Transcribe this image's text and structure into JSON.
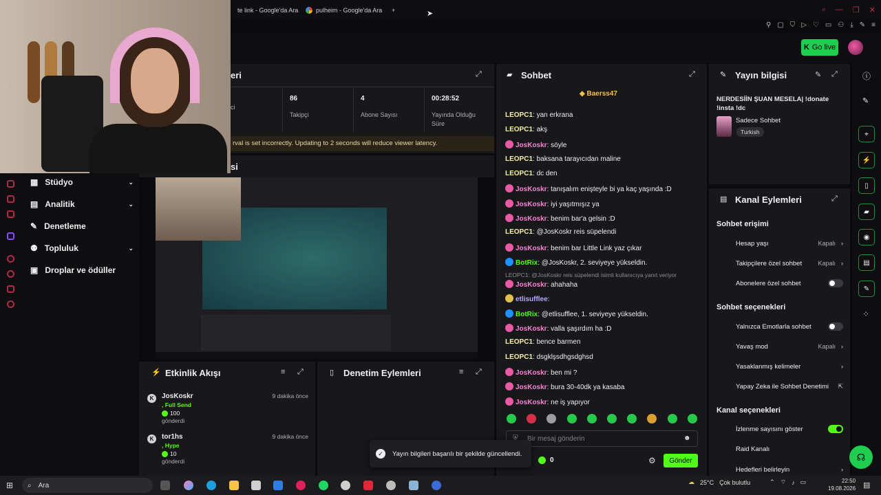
{
  "browser": {
    "tabs": [
      {
        "label": "te link - Google'da Ara"
      },
      {
        "label": "pulheim - Google'da Ara"
      }
    ],
    "new_tab_label": "+"
  },
  "header": {
    "go_live_label": "Go live"
  },
  "sidebar": {
    "items": [
      {
        "label": "Stüdyo",
        "expandable": true,
        "icon": "folder-icon"
      },
      {
        "label": "Analitik",
        "expandable": true,
        "icon": "chart-icon"
      },
      {
        "label": "Denetleme",
        "expandable": false,
        "icon": "wrench-icon"
      },
      {
        "label": "Topluluk",
        "expandable": true,
        "icon": "community-icon"
      },
      {
        "label": "Droplar ve ödüller",
        "expandable": false,
        "icon": "gift-icon"
      }
    ]
  },
  "stats": {
    "title_fragment": "eri",
    "cells": [
      {
        "value": "",
        "label": "ci"
      },
      {
        "value": "86",
        "label": "Takipçi"
      },
      {
        "value": "4",
        "label": "Abone Sayısı"
      },
      {
        "value": "00:28:52",
        "label": "Yayında Olduğu Süre"
      }
    ],
    "warning": "rval is set incorrectly. Updating to 2 seconds will reduce viewer latency."
  },
  "preview": {
    "title_fragment": "si"
  },
  "activity": {
    "title": "Etkinlik Akışı",
    "events": [
      {
        "user": "JosKoskr",
        "action": ", Full Send",
        "amount": "100",
        "verb": "gönderdi",
        "time": "9 dakika önce"
      },
      {
        "user": "tor1hs",
        "action": ", Hype",
        "amount": "10",
        "verb": "gönderdi",
        "time": "9 dakika önce"
      }
    ]
  },
  "moderation": {
    "title": "Denetim Eylemleri"
  },
  "chat": {
    "title": "Sohbet",
    "pinned_user": "Baerss47",
    "messages": [
      {
        "user": "LEOPC1",
        "text": "yan erkrana",
        "color": "#f5f0a8",
        "badge": ""
      },
      {
        "user": "LEOPC1",
        "text": "akş",
        "color": "#f5f0a8",
        "badge": ""
      },
      {
        "user": "JosKoskr",
        "text": "söyle",
        "color": "#ff7fd6",
        "badge": "#e85aa5"
      },
      {
        "user": "LEOPC1",
        "text": "baksana tarayıcıdan maline",
        "color": "#f5f0a8",
        "badge": ""
      },
      {
        "user": "LEOPC1",
        "text": "dc den",
        "color": "#f5f0a8",
        "badge": ""
      },
      {
        "user": "JosKoskr",
        "text": "tanışalım enişteyle bi ya kaç yaşında :D",
        "color": "#ff7fd6",
        "badge": "#e85aa5"
      },
      {
        "user": "JosKoskr",
        "text": "iyi yaşıtmışız ya",
        "color": "#ff7fd6",
        "badge": "#e85aa5"
      },
      {
        "user": "JosKoskr",
        "text": "benim bar'a gelsin :D",
        "color": "#ff7fd6",
        "badge": "#e85aa5"
      },
      {
        "user": "LEOPC1",
        "text": "@JosKoskr reis süpelendi",
        "color": "#f5f0a8",
        "badge": ""
      },
      {
        "user": "JosKoskr",
        "text": "benim bar Little Link yaz çıkar",
        "color": "#ff7fd6",
        "badge": "#e85aa5"
      },
      {
        "user": "BotRix",
        "text": "@JosKoskr, 2. seviyeye yükseldin.",
        "color": "#53fc18",
        "badge": "#1e90ff"
      },
      {
        "user": "JosKoskr",
        "text": "ahahaha",
        "color": "#ff7fd6",
        "badge": "#e85aa5"
      },
      {
        "user": "etlisufflee",
        "text": "",
        "color": "#b9a7ff",
        "badge": "#e0c04a"
      },
      {
        "user": "BotRix",
        "text": "@etlisufflee, 1. seviyeye yükseldin.",
        "color": "#53fc18",
        "badge": "#1e90ff"
      },
      {
        "user": "JosKoskr",
        "text": "valla şaşırdım ha :D",
        "color": "#ff7fd6",
        "badge": "#e85aa5"
      },
      {
        "user": "LEOPC1",
        "text": "bence barmen",
        "color": "#f5f0a8",
        "badge": ""
      },
      {
        "user": "LEOPC1",
        "text": "dsgklşsdhgsdghsd",
        "color": "#f5f0a8",
        "badge": ""
      },
      {
        "user": "JosKoskr",
        "text": "ben mi ?",
        "color": "#ff7fd6",
        "badge": "#e85aa5"
      },
      {
        "user": "JosKoskr",
        "text": "bura 30-40dk ya kasaba",
        "color": "#ff7fd6",
        "badge": "#e85aa5"
      },
      {
        "user": "JosKoskr",
        "text": "ne iş yapıyor",
        "color": "#ff7fd6",
        "badge": "#e85aa5"
      }
    ],
    "reply_hint": "LEOPC1: @JosKoskr reis süpelendi isimli kullanıcıya yanıt veriyor",
    "input_placeholder": "Bir mesaj gönderin",
    "balance": "0",
    "send_label": "Gönder"
  },
  "stream_info": {
    "title": "Yayın bilgisi",
    "stream_title": "NERDESİİN ŞUAN MESELA| !donate !insta !dc",
    "category": "Sadece Sohbet",
    "language": "Turkish"
  },
  "channel_actions": {
    "title": "Kanal Eylemleri",
    "chat_access": {
      "heading": "Sohbet erişimi",
      "rows": [
        {
          "label": "Hesap yaşı",
          "value": "Kapalı",
          "type": "arrow"
        },
        {
          "label": "Takipçilere özel sohbet",
          "value": "Kapalı",
          "type": "arrow"
        },
        {
          "label": "Abonelere özel sohbet",
          "value": "",
          "type": "toggle-off"
        }
      ]
    },
    "chat_options": {
      "heading": "Sohbet seçenekleri",
      "rows": [
        {
          "label": "Yalnızca Emotlarla sohbet",
          "value": "",
          "type": "toggle-off"
        },
        {
          "label": "Yavaş mod",
          "value": "Kapalı",
          "type": "arrow"
        },
        {
          "label": "Yasaklanmış kelimeler",
          "value": "",
          "type": "arrow"
        },
        {
          "label": "Yapay Zeka ile Sohbet Denetimi",
          "value": "",
          "type": "external"
        }
      ]
    },
    "channel_options": {
      "heading": "Kanal seçenekleri",
      "rows": [
        {
          "label": "İzlenme sayısını göster",
          "value": "",
          "type": "toggle-on"
        },
        {
          "label": "Raid Kanalı",
          "value": "",
          "type": "none"
        },
        {
          "label": "Hedefleri belirleyin",
          "value": "",
          "type": "arrow"
        }
      ]
    }
  },
  "toast": {
    "message": "Yayın bilgileri başarılı bir şekilde güncellendi."
  },
  "taskbar": {
    "search_placeholder": "Ara",
    "weather_temp": "25°C",
    "weather_desc": "Çok bulutlu",
    "time": "22:50",
    "date": "19.08.2026"
  },
  "colors": {
    "accent": "#53fc18",
    "panel": "#18181b",
    "background": "#0b0b0d"
  }
}
